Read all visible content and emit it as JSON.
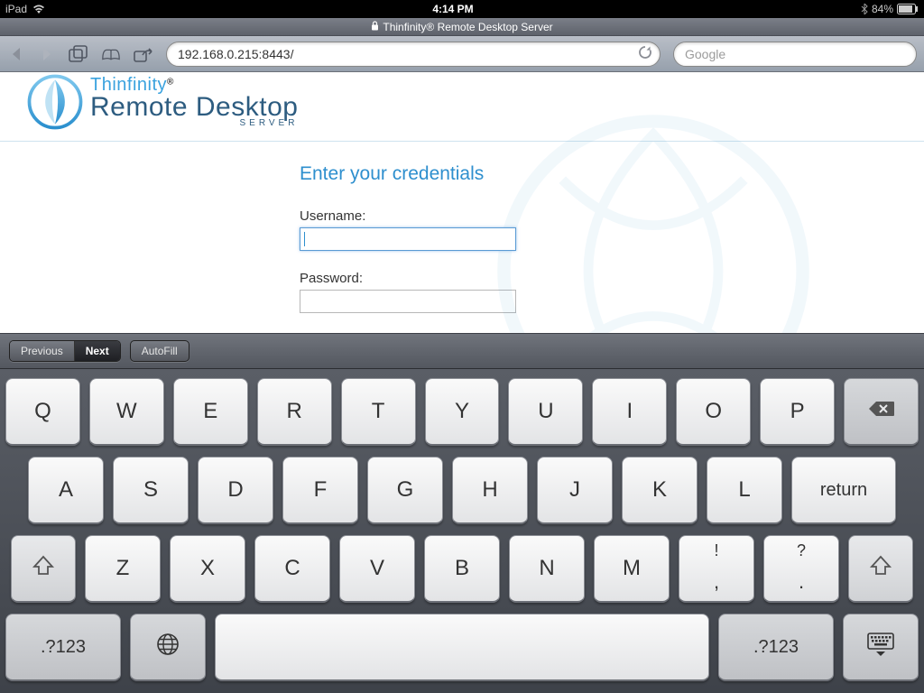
{
  "statusbar": {
    "device": "iPad",
    "time": "4:14 PM",
    "battery_pct": "84%"
  },
  "page_title": "Thinfinity® Remote Desktop Server",
  "toolbar": {
    "url": "192.168.0.215:8443/",
    "search_placeholder": "Google"
  },
  "logo": {
    "brand": "Thinfinity",
    "registered": "®",
    "product": "Remote Desktop",
    "sub": "SERVER"
  },
  "login": {
    "heading": "Enter your credentials",
    "username_label": "Username:",
    "username_value": "",
    "password_label": "Password:",
    "password_value": ""
  },
  "kbacc": {
    "prev": "Previous",
    "next": "Next",
    "autofill": "AutoFill"
  },
  "keys": {
    "row1": [
      "Q",
      "W",
      "E",
      "R",
      "T",
      "Y",
      "U",
      "I",
      "O",
      "P"
    ],
    "row2": [
      "A",
      "S",
      "D",
      "F",
      "G",
      "H",
      "J",
      "K",
      "L"
    ],
    "row2_return": "return",
    "row3": [
      "Z",
      "X",
      "C",
      "V",
      "B",
      "N",
      "M"
    ],
    "row3_punc1_top": "!",
    "row3_punc1_bot": ",",
    "row3_punc2_top": "?",
    "row3_punc2_bot": ".",
    "mode": ".?123"
  }
}
